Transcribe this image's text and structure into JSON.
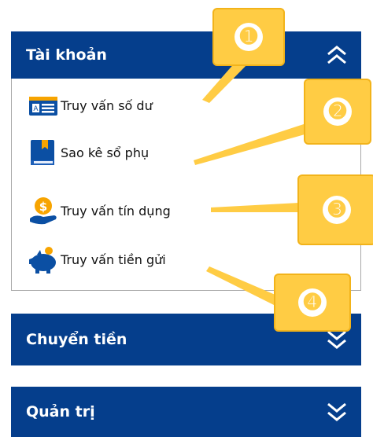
{
  "sections": {
    "account": {
      "title": "Tài khoản",
      "state": "expanded",
      "chevron_icon": "chevron-up-double-icon"
    },
    "transfer": {
      "title": "Chuyển tiền",
      "state": "collapsed",
      "chevron_icon": "chevron-down-double-icon"
    },
    "admin": {
      "title": "Quản trị",
      "state": "collapsed",
      "chevron_icon": "chevron-down-double-icon"
    }
  },
  "account_items": [
    {
      "label": "Truy vấn số dư",
      "icon": "id-card-icon"
    },
    {
      "label": "Sao kê sổ phụ",
      "icon": "book-icon"
    },
    {
      "label": "Truy vấn tín dụng",
      "icon": "coin-hand-icon"
    },
    {
      "label": "Truy vấn tiền gửi",
      "icon": "piggy-bank-icon"
    }
  ],
  "callouts": [
    "➊",
    "➋",
    "➌",
    "➍"
  ],
  "colors": {
    "header_bg": "#053e8c",
    "header_text": "#ffffff",
    "callout_fill": "#ffcc44",
    "icon_blue": "#0b4fa3",
    "icon_orange": "#f7a400"
  }
}
